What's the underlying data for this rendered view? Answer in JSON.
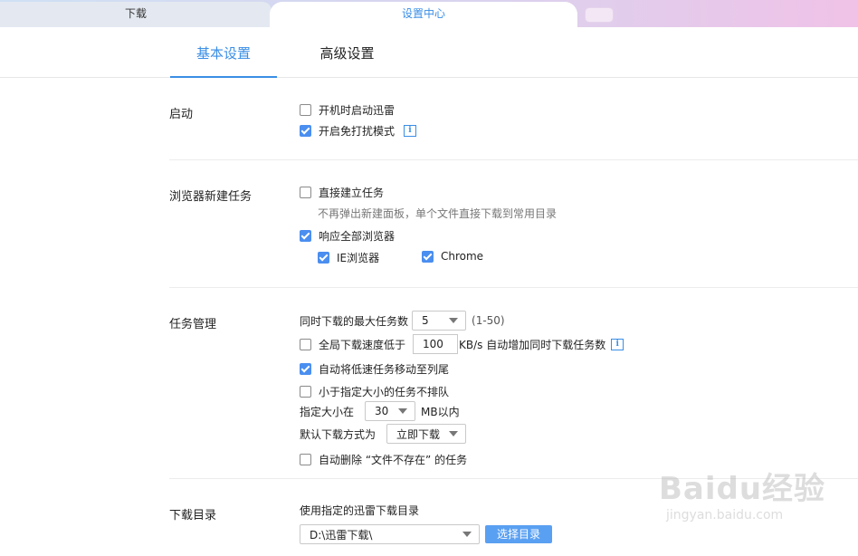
{
  "tabs": {
    "download": "下载",
    "settings": "设置中心"
  },
  "subtabs": {
    "basic": "基本设置",
    "advanced": "高级设置"
  },
  "sections": {
    "startup": {
      "label": "启动",
      "boot_start": {
        "label": "开机时启动迅雷",
        "checked": false
      },
      "dnd_mode": {
        "label": "开启免打扰模式",
        "checked": true
      }
    },
    "browser": {
      "label": "浏览器新建任务",
      "direct_create": {
        "label": "直接建立任务",
        "checked": false
      },
      "direct_hint": "不再弹出新建面板，单个文件直接下载到常用目录",
      "respond_all": {
        "label": "响应全部浏览器",
        "checked": true
      },
      "ie": {
        "label": "IE浏览器",
        "checked": true
      },
      "chrome": {
        "label": "Chrome",
        "checked": true
      }
    },
    "tasks": {
      "label": "任务管理",
      "max_tasks_label": "同时下载的最大任务数",
      "max_tasks_value": "5",
      "max_tasks_range": "(1-50)",
      "speed_below": {
        "label": "全局下载速度低于",
        "checked": false
      },
      "speed_value": "100",
      "speed_suffix": "KB/s 自动增加同时下载任务数",
      "move_slow": {
        "label": "自动将低速任务移动至列尾",
        "checked": true
      },
      "no_queue_small": {
        "label": "小于指定大小的任务不排队",
        "checked": false
      },
      "size_label": "指定大小在",
      "size_value": "30",
      "size_suffix": "MB以内",
      "default_mode_label": "默认下载方式为",
      "default_mode_value": "立即下载",
      "auto_delete": {
        "label": "自动删除 “文件不存在” 的任务",
        "checked": false
      }
    },
    "directory": {
      "label": "下载目录",
      "use_dir_label": "使用指定的迅雷下载目录",
      "path_value": "D:\\迅雷下载\\",
      "choose_button": "选择目录"
    }
  },
  "watermark": {
    "main": "Baidu经验",
    "sub": "jingyan.baidu.com"
  },
  "colors": {
    "accent": "#3a8ee6",
    "checkbox_checked": "#4a8ef0",
    "button": "#5aa0f2"
  }
}
